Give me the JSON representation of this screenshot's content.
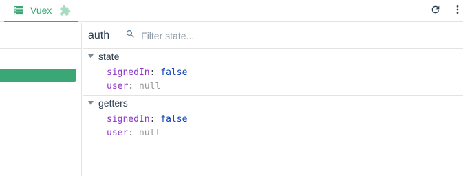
{
  "tabs": [
    {
      "label": "Vuex",
      "icon": "database-icon",
      "active": true
    }
  ],
  "toolbar": {
    "refresh_icon": "refresh-icon",
    "menu_icon": "more-vert-icon"
  },
  "colors": {
    "accent": "#3ba776",
    "key": "#8e38c9",
    "boolean": "#0b3fb5",
    "null": "#999999"
  },
  "inspector": {
    "module_name": "auth",
    "filter_placeholder": "Filter state..."
  },
  "sections": [
    {
      "title": "state",
      "rows": [
        {
          "key": "signedIn",
          "value": "false",
          "type": "boolean"
        },
        {
          "key": "user",
          "value": "null",
          "type": "null"
        }
      ]
    },
    {
      "title": "getters",
      "rows": [
        {
          "key": "signedIn",
          "value": "false",
          "type": "boolean"
        },
        {
          "key": "user",
          "value": "null",
          "type": "null"
        }
      ]
    }
  ]
}
